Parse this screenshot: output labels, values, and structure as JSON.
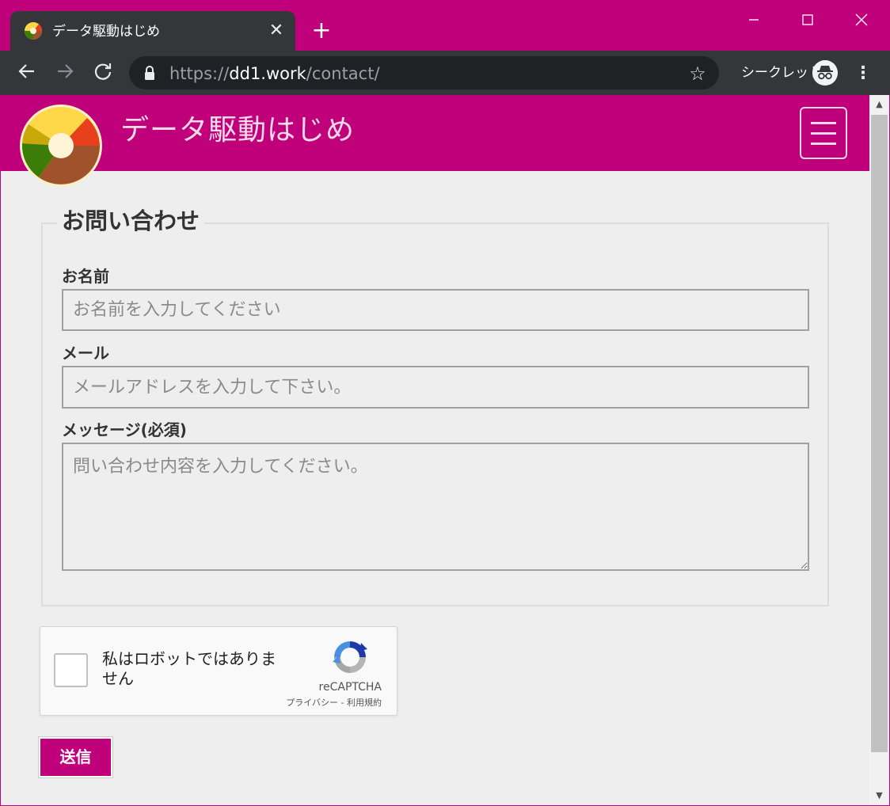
{
  "browser": {
    "tab_title": "データ駆動はじめ",
    "tab_close": "✕",
    "new_tab": "+",
    "url_scheme": "https://",
    "url_host": "dd1.work",
    "url_path": "/contact/",
    "incognito_label": "シークレット",
    "icons": {
      "back": "back-arrow-icon",
      "forward": "forward-arrow-icon",
      "reload": "reload-icon",
      "lock": "lock-icon",
      "star": "star-icon",
      "incognito": "incognito-icon",
      "menu": "kebab-menu-icon"
    },
    "colors": {
      "frame": "#c0007a",
      "toolbar": "#35363a",
      "omnibox": "#202124"
    }
  },
  "site": {
    "title": "データ駆動はじめ",
    "brand_color": "#c0007a"
  },
  "form": {
    "legend": "お問い合わせ",
    "name_label": "お名前",
    "name_placeholder": "お名前を入力してください",
    "email_label": "メール",
    "email_placeholder": "メールアドレスを入力して下さい。",
    "message_label": "メッセージ(必須)",
    "message_placeholder": "問い合わせ内容を入力してください。",
    "submit_label": "送信"
  },
  "recaptcha": {
    "checkbox_label": "私はロボットではありません",
    "brand": "reCAPTCHA",
    "links": "プライバシー - 利用規約"
  }
}
